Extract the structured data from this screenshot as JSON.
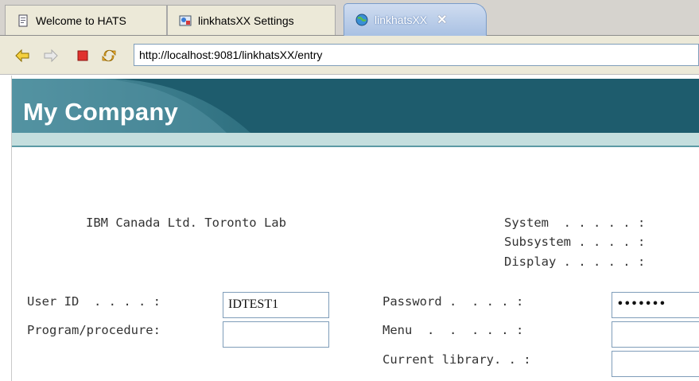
{
  "tabs": [
    {
      "label": "Welcome to HATS",
      "icon": "document-icon",
      "active": false
    },
    {
      "label": "linkhatsXX Settings",
      "icon": "settings-icon",
      "active": false
    },
    {
      "label": "linkhatsXX",
      "icon": "globe-icon",
      "active": true
    }
  ],
  "browser": {
    "url": "http://localhost:9081/linkhatsXX/entry",
    "back_icon": "back-arrow-icon",
    "forward_icon": "forward-arrow-icon",
    "stop_icon": "stop-icon",
    "refresh_icon": "refresh-icon"
  },
  "page": {
    "company": "My Company",
    "header_line": "IBM Canada Ltd. Toronto Lab",
    "system_labels": [
      "System  . . . . . :",
      "Subsystem . . . . :",
      "Display . . . . . :"
    ],
    "fields": {
      "user_id": {
        "label": "User ID  . . . . :",
        "value": "IDTEST1"
      },
      "program": {
        "label": "Program/procedure:",
        "value": ""
      },
      "password": {
        "label": "Password .  . . . :",
        "value": "•••••••"
      },
      "menu": {
        "label": "Menu  .  .  . . . :",
        "value": ""
      },
      "library": {
        "label": "Current library. . :",
        "value": ""
      }
    }
  },
  "colors": {
    "banner": "#1e5c6d",
    "band": "#c4dede",
    "active_tab": "#a9c1e3"
  }
}
